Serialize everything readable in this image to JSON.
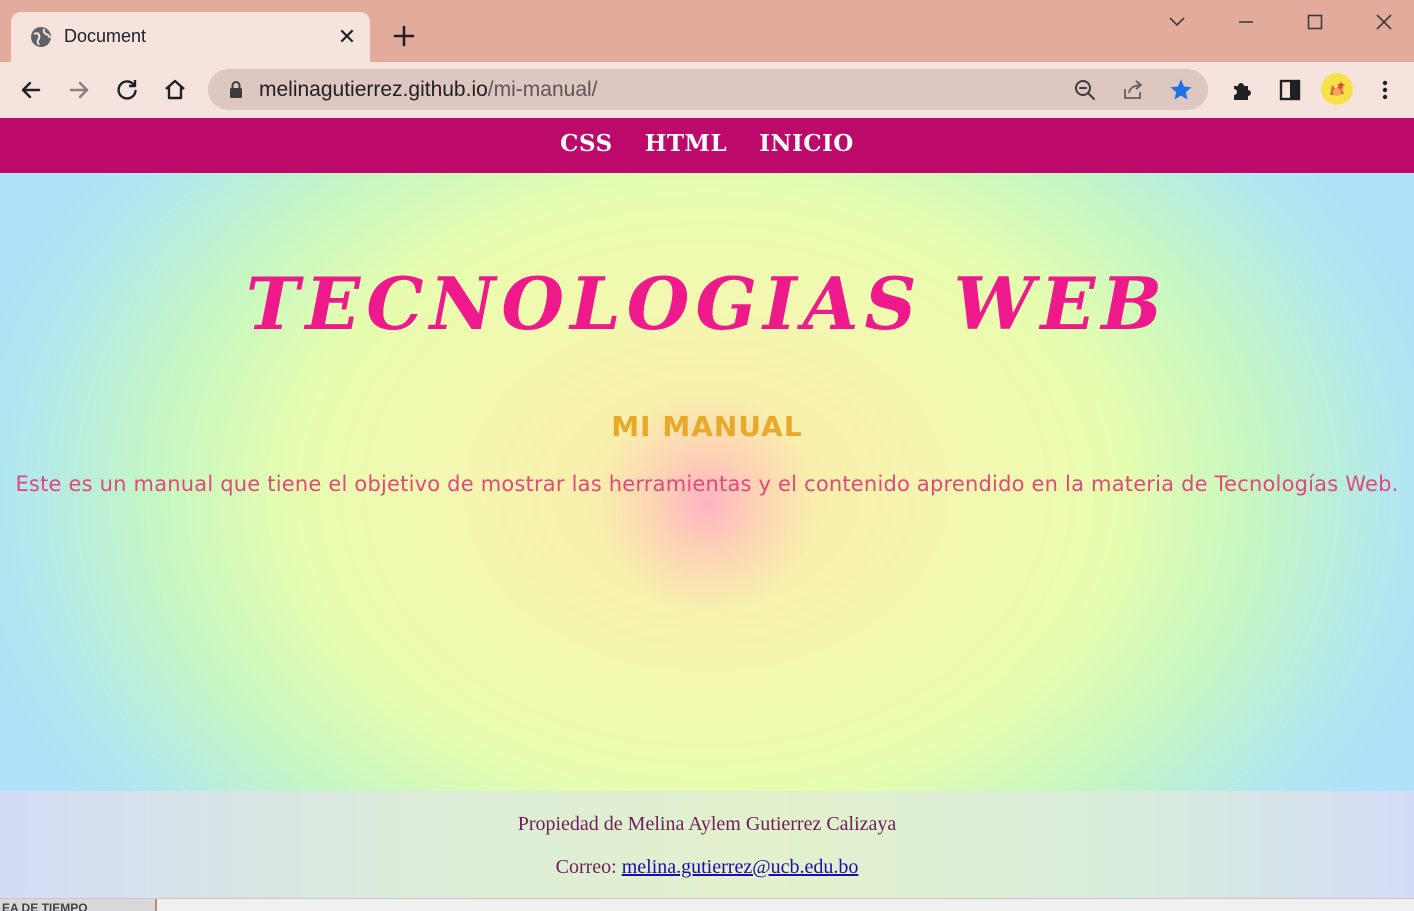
{
  "browser": {
    "tab": {
      "title": "Document",
      "favicon": "globe-icon",
      "close_glyph": "✕"
    },
    "new_tab_icon": "plus-icon",
    "window_controls": [
      "chevron-down-icon",
      "minimize-icon",
      "maximize-icon",
      "close-icon"
    ],
    "address_bar": {
      "host": "melinagutierrez.github.io",
      "path": "/mi-manual/"
    },
    "bookmark_star_color": "#1a73e8"
  },
  "page": {
    "nav": {
      "links": [
        "CSS",
        "HTML",
        "INICIO"
      ],
      "background": "#bd0a6a"
    },
    "hero": {
      "title": "TECNOLOGIAS WEB",
      "subtitle": "MI MANUAL",
      "description": "Este es un manual que tiene el objetivo de mostrar las herramientas y el contenido aprendido en la materia de Tecnologías Web."
    },
    "footer": {
      "owner": "Propiedad de Melina Aylem Gutierrez Calizaya",
      "email_label": "Correo:",
      "email": "melina.gutierrez@ucb.edu.bo"
    }
  },
  "colors": {
    "title": "#ee1a8c",
    "subtitle": "#e8a92b",
    "description": "#e0497c",
    "footer_text": "#6d1f58",
    "link": "#1a0dab"
  },
  "taskbar": {
    "partial_label": "EA DE TIEMPO"
  }
}
